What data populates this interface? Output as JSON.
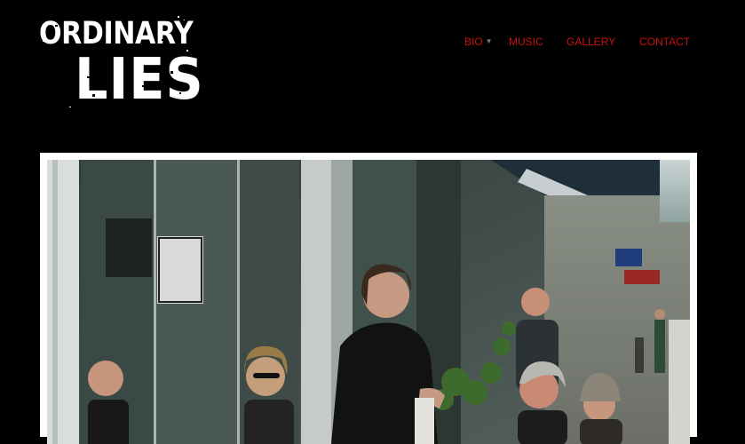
{
  "site": {
    "logo_line1": "ORDINARY",
    "logo_line2": "LIES"
  },
  "nav": {
    "items": [
      {
        "label": "BIO",
        "has_dropdown": true
      },
      {
        "label": "MUSIC"
      },
      {
        "label": "GALLERY"
      },
      {
        "label": "CONTACT"
      }
    ]
  },
  "colors": {
    "background": "#000000",
    "nav_link": "#c81010",
    "frame": "#ffffff"
  },
  "hero": {
    "image_icon": "band-photo"
  }
}
